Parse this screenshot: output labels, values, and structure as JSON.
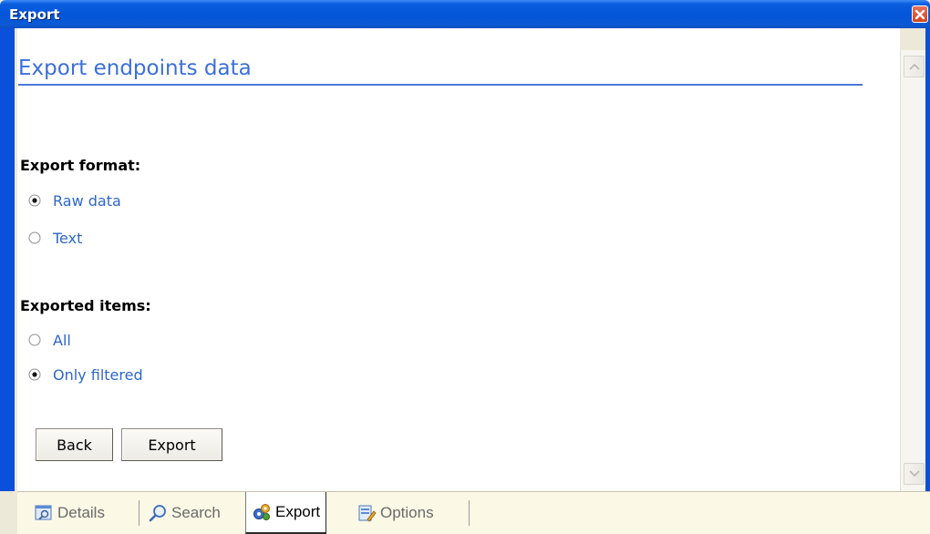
{
  "window": {
    "title": "Export",
    "close_icon": "close-icon"
  },
  "page": {
    "heading": "Export endpoints data",
    "format_section": {
      "heading": "Export format:",
      "options": [
        {
          "label": "Raw data",
          "selected": true
        },
        {
          "label": "Text",
          "selected": false
        }
      ]
    },
    "items_section": {
      "heading": "Exported items:",
      "options": [
        {
          "label": "All",
          "selected": false
        },
        {
          "label": "Only filtered",
          "selected": true
        }
      ]
    },
    "buttons": {
      "back": "Back",
      "export": "Export"
    }
  },
  "tabs": [
    {
      "label": "Details",
      "icon": "details-icon",
      "active": false
    },
    {
      "label": "Search",
      "icon": "search-icon",
      "active": false
    },
    {
      "label": "Export",
      "icon": "export-gears-icon",
      "active": true
    },
    {
      "label": "Options",
      "icon": "options-icon",
      "active": false
    }
  ],
  "colors": {
    "titlebar": "#0455d8",
    "accent_text": "#3b6fd9",
    "tabstrip": "#fbf8e6"
  }
}
